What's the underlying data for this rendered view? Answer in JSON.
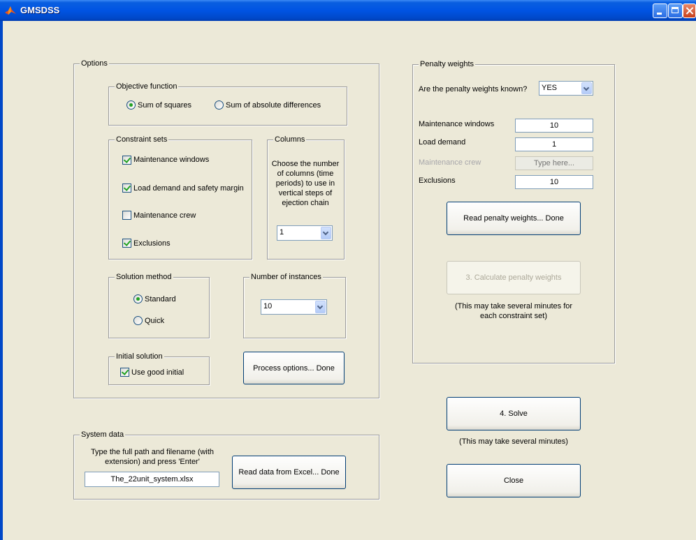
{
  "window": {
    "title": "GMSDSS"
  },
  "options": {
    "legend": "Options",
    "objective": {
      "legend": "Objective function",
      "sum_squares": "Sum of squares",
      "sum_abs": "Sum of absolute differences",
      "selected": "sum_squares"
    },
    "constraints": {
      "legend": "Constraint sets",
      "maintenance_windows": "Maintenance windows",
      "load_demand": "Load demand and safety margin",
      "maintenance_crew": "Maintenance crew",
      "exclusions": "Exclusions"
    },
    "columns": {
      "legend": "Columns",
      "description": "Choose the number of columns (time periods) to use in vertical steps of ejection chain",
      "value": "1"
    },
    "solution_method": {
      "legend": "Solution method",
      "standard": "Standard",
      "quick": "Quick",
      "selected": "standard"
    },
    "instances": {
      "legend": "Number of instances",
      "value": "10"
    },
    "initial": {
      "legend": "Initial solution",
      "use_good": "Use good initial"
    },
    "process_button": "Process options... Done"
  },
  "system_data": {
    "legend": "System data",
    "instructions": "Type the full path and filename (with extension) and press 'Enter'",
    "path_value": "The_22unit_system.xlsx",
    "read_button": "Read data from Excel... Done"
  },
  "penalty": {
    "legend": "Penalty weights",
    "known_label": "Are the penalty weights known?",
    "known_value": "YES",
    "rows": {
      "maintenance_windows": {
        "label": "Maintenance windows",
        "value": "10"
      },
      "load_demand": {
        "label": "Load demand",
        "value": "1"
      },
      "maintenance_crew": {
        "label": "Maintenance crew",
        "placeholder": "Type here..."
      },
      "exclusions": {
        "label": "Exclusions",
        "value": "10"
      }
    },
    "read_button": "Read penalty weights... Done",
    "calc_button": "3. Calculate penalty weights",
    "calc_note": "(This may take several minutes for each constraint set)"
  },
  "solve": {
    "button": "4. Solve",
    "note": "(This may take several minutes)"
  },
  "close_button": "Close",
  "colors": {
    "titlebar": "#0054e3",
    "background": "#ece9d8",
    "check_green": "#21a121"
  }
}
